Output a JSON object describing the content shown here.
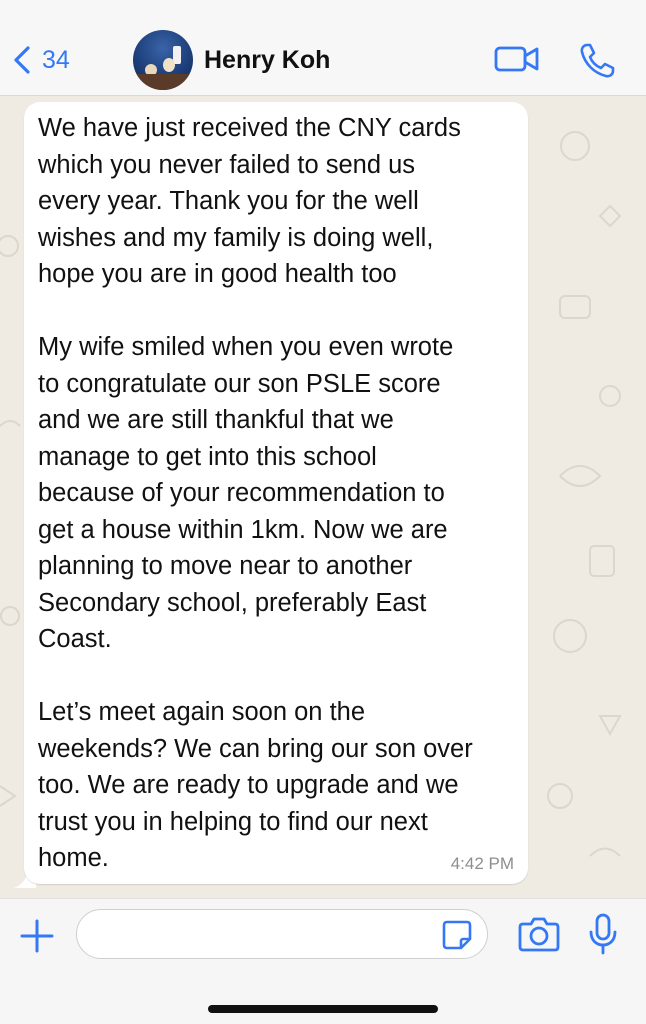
{
  "header": {
    "back_count": "34",
    "contact_name": "Henry Koh",
    "icons": [
      "chevron-left-icon",
      "video-call-icon",
      "phone-icon"
    ]
  },
  "message": {
    "paragraph_1": "We have just received the CNY cards\nwhich you never failed to send us\nevery year. Thank you for the well\nwishes and my family is doing well,\nhope you are in good health too",
    "paragraph_2": "My wife smiled when you even wrote\nto congratulate our son PSLE score\nand we are still thankful that we\nmanage to get into this school\nbecause of your recommendation to\nget a house within 1km. Now we are\nplanning to move near to another\nSecondary school, preferably East\nCoast.",
    "paragraph_3": "Let’s meet again soon on the\nweekends? We can bring our son over\ntoo. We are ready to upgrade and we\ntrust you in helping to find our next\nhome.",
    "time": "4:42 PM"
  },
  "composer": {
    "input_value": "",
    "icons": [
      "plus-icon",
      "sticker-icon",
      "camera-icon",
      "microphone-icon"
    ]
  },
  "colors": {
    "accent": "#3478f6",
    "chat_background": "#efeae2",
    "bubble": "#ffffff"
  }
}
